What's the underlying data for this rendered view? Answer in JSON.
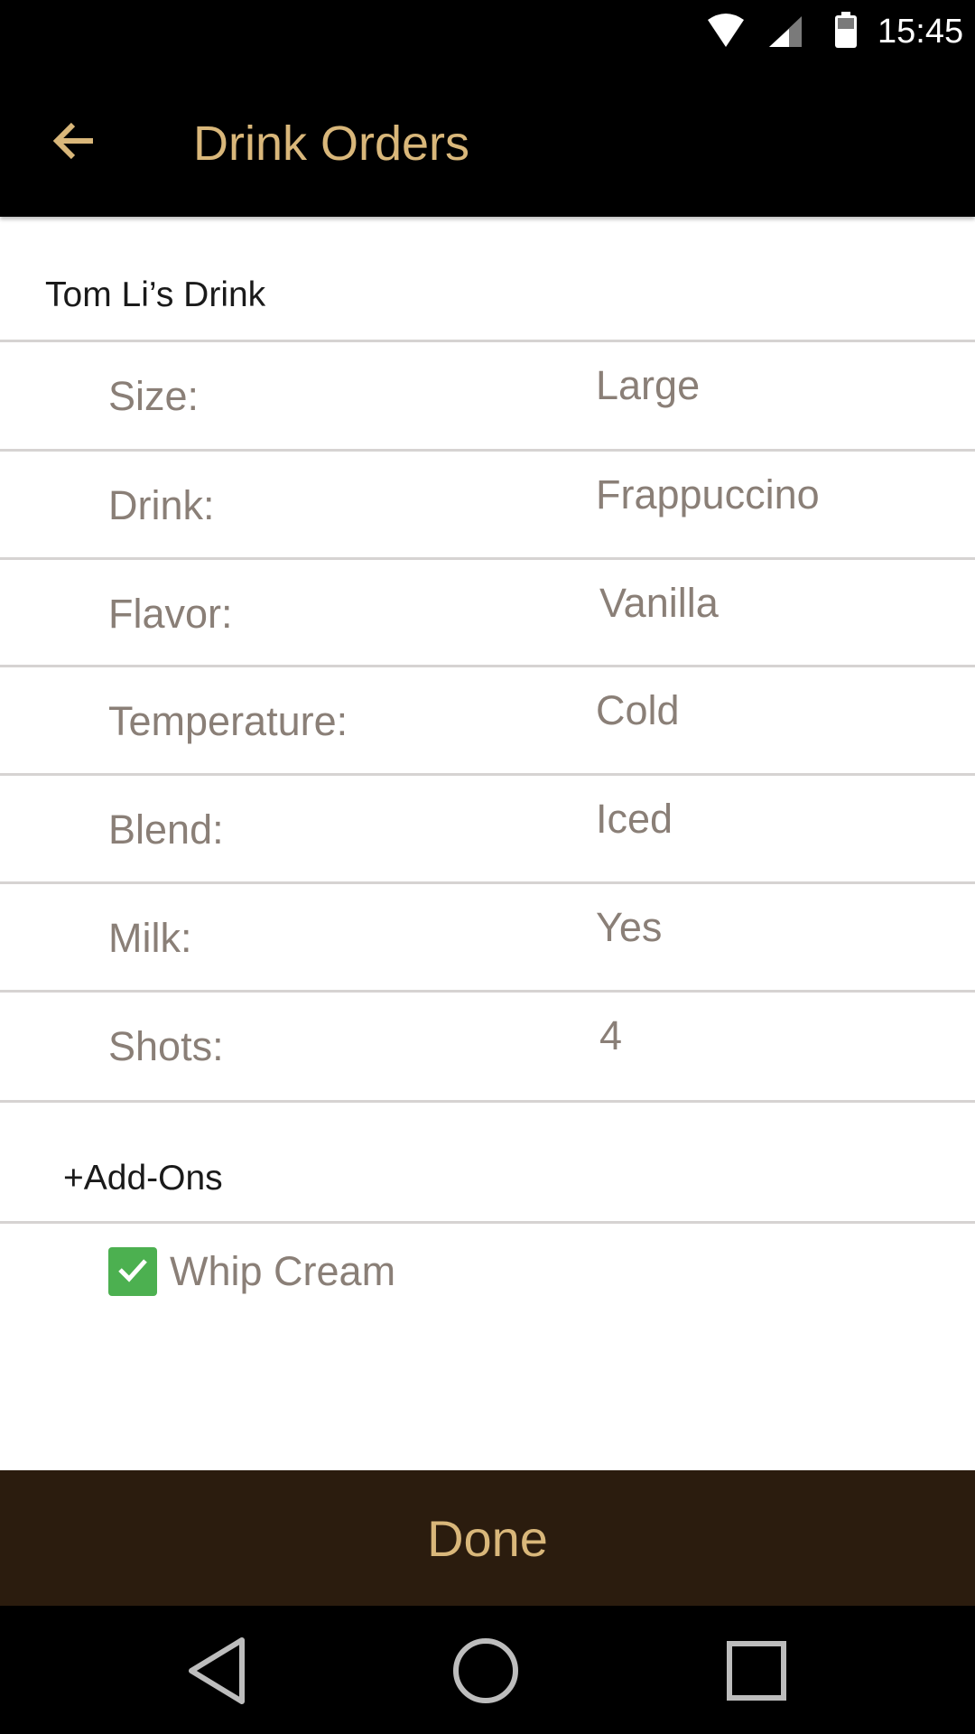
{
  "status_bar": {
    "time": "15:45",
    "icons": [
      "wifi-icon",
      "cell-signal-icon",
      "battery-icon"
    ]
  },
  "app_bar": {
    "title": "Drink Orders",
    "back_icon": "arrow-back-icon"
  },
  "order": {
    "title": "Tom Li’s Drink",
    "rows": [
      {
        "label": "Size:",
        "value": "Large"
      },
      {
        "label": "Drink:",
        "value": "Frappuccino"
      },
      {
        "label": "Flavor:",
        "value": "Vanilla"
      },
      {
        "label": "Temperature:",
        "value": "Cold"
      },
      {
        "label": "Blend:",
        "value": "Iced"
      },
      {
        "label": "Milk:",
        "value": "Yes"
      },
      {
        "label": "Shots:",
        "value": "4"
      }
    ]
  },
  "addons": {
    "header": "+Add-Ons",
    "items": [
      {
        "label": "Whip Cream",
        "checked": true
      }
    ]
  },
  "done_button": {
    "label": "Done"
  },
  "nav_bar": {
    "icons": [
      "nav-back-icon",
      "nav-home-icon",
      "nav-recents-icon"
    ]
  },
  "colors": {
    "accent_gold": "#d9b77a",
    "done_bg": "#2b1c0e",
    "muted_text": "#8a7f77",
    "checkbox_green": "#4cb050",
    "divider": "#d6d3d2"
  }
}
